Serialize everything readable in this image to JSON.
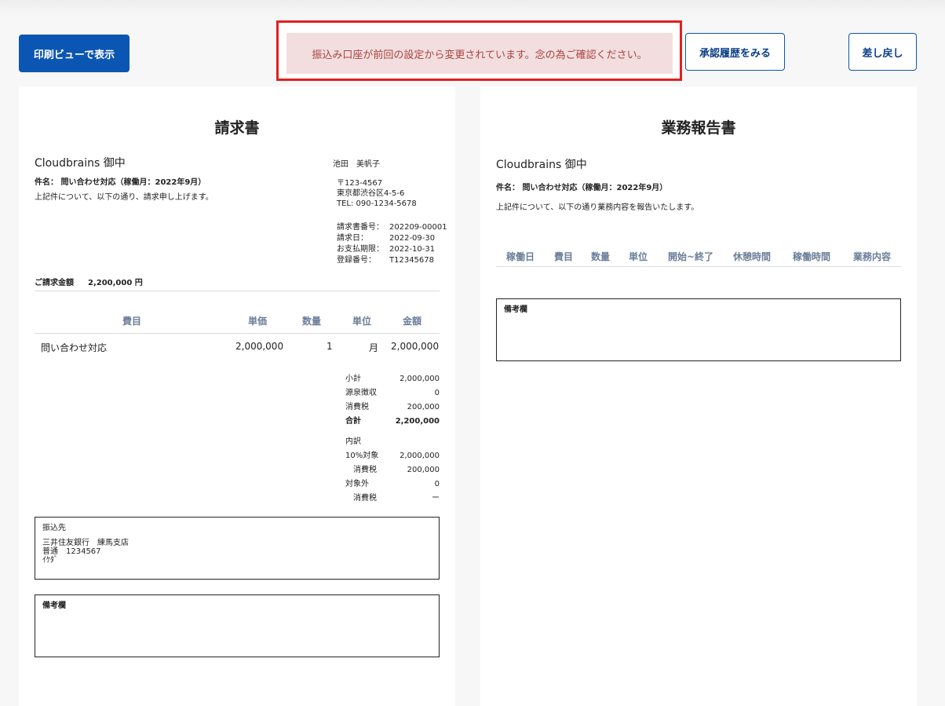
{
  "toolbar": {
    "print_label": "印刷ビューで表示",
    "alert_text": "振込み口座が前回の設定から変更されています。念の為ご確認ください。",
    "history_label": "承認履歴をみる",
    "return_label": "差し戻し"
  },
  "invoice": {
    "title": "請求書",
    "client": "Cloudbrains 御中",
    "subject": "件名： 問い合わせ対応（稼働月：2022年9月）",
    "intro": "上記件について、以下の通り、請求申し上げます。",
    "issuer_name": "池田　美帆子",
    "address": [
      "〒123-4567",
      "東京都渋谷区4-5-6",
      "TEL: 090-1234-5678"
    ],
    "meta": [
      {
        "k": "請求書番号：",
        "v": "202209-00001"
      },
      {
        "k": "請求日：",
        "v": "2022-09-30"
      },
      {
        "k": "お支払期限：",
        "v": "2022-10-31"
      },
      {
        "k": "登録番号：",
        "v": "T12345678"
      }
    ],
    "total_label": "ご請求金額",
    "total_amount": "2,200,000 円",
    "columns": [
      "費目",
      "単価",
      "数量",
      "単位",
      "金額"
    ],
    "row": {
      "item": "問い合わせ対応",
      "price": "2,000,000",
      "qty": "1",
      "unit": "月",
      "amount": "2,000,000"
    },
    "summary": [
      {
        "k": "小計",
        "v": "2,000,000"
      },
      {
        "k": "源泉徴収",
        "v": "0"
      },
      {
        "k": "消費税",
        "v": "200,000"
      },
      {
        "k": "合計",
        "v": "2,200,000"
      }
    ],
    "breakdown_label": "内訳",
    "breakdown": [
      {
        "k": "10%対象",
        "v": "2,000,000"
      },
      {
        "k": "消費税",
        "v": "200,000"
      },
      {
        "k": "対象外",
        "v": "0"
      },
      {
        "k": "消費税",
        "v": "ー"
      }
    ],
    "bank_label": "振込先",
    "bank_lines": [
      "三井住友銀行　練馬支店",
      "普通　1234567",
      "ｲｹﾀﾞ"
    ],
    "notes_label": "備考欄"
  },
  "report": {
    "title": "業務報告書",
    "client": "Cloudbrains 御中",
    "subject": "件名： 問い合わせ対応（稼働月：2022年9月）",
    "intro": "上記件について、以下の通り業務内容を報告いたします。",
    "columns": [
      "稼働日",
      "費目",
      "数量",
      "単位",
      "開始~終了",
      "休憩時間",
      "稼働時間",
      "業務内容"
    ],
    "notes_label": "備考欄"
  }
}
